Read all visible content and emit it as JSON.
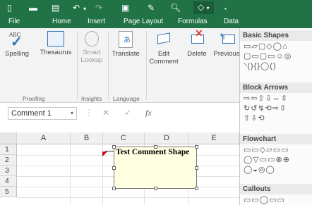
{
  "qat": {
    "save_icon": "save-icon",
    "undo_icon": "undo-icon",
    "redo_icon": "redo-icon",
    "shapes_dropdown": "▾"
  },
  "tabs": [
    "File",
    "Home",
    "Insert",
    "Page Layout",
    "Formulas",
    "Data"
  ],
  "ribbon": {
    "commands": {
      "spelling": "Spelling",
      "thesaurus": "Thesaurus",
      "smart": "Smart",
      "lookup": "Lookup",
      "translate": "Translate",
      "edit": "Edit",
      "comment": "Comment",
      "delete": "Delete",
      "previous": "Previous"
    },
    "groups": {
      "proofing": "Proofing",
      "insights": "Insights",
      "language": "Language"
    },
    "abc": "ABC"
  },
  "formula_bar": {
    "name_box": "Comment 1",
    "cancel": "✕",
    "enter": "✓",
    "fx": "fx"
  },
  "grid": {
    "columns": [
      "A",
      "B",
      "C",
      "D",
      "E"
    ],
    "rows": [
      "1",
      "2",
      "3",
      "4",
      "5"
    ]
  },
  "comment": {
    "text": "Test Comment Shape"
  },
  "shapes_panel": {
    "headers": {
      "basic": "Basic Shapes",
      "arrows": "Block Arrows",
      "flow": "Flowchart",
      "callouts": "Callouts"
    },
    "basic_rows": [
      "▭▱▢◇◯⌂",
      "▢▭▢▭☺◎",
      "◝(){}◯()"
    ],
    "arrow_rows": [
      "⇨⇦⇧⇩⇔⇳",
      "↻↺↯⟲⇨⇳",
      "⇧⇩⟲"
    ],
    "flow_rows": [
      "▭▭◇▱▭▭",
      "◯▽▭▭⊗⊕",
      "◯◒◎◯"
    ],
    "callout_rows": [
      "▭▭◯▭▭"
    ]
  },
  "colors": {
    "excel_green": "#217346"
  }
}
